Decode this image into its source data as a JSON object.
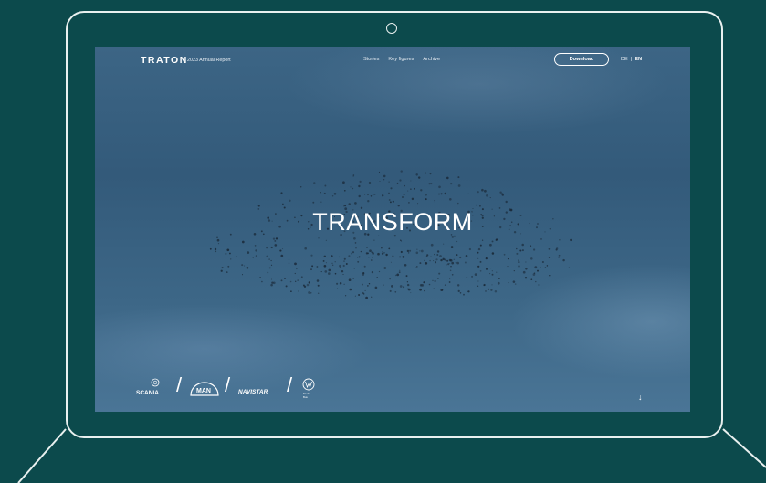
{
  "nav": {
    "logo": "TRATON",
    "subtitle": "/ 2023 Annual Report",
    "links": [
      "Stories",
      "Key figures",
      "Archive"
    ],
    "download_label": "Download",
    "lang_de": "DE",
    "lang_sep": "|",
    "lang_en": "EN"
  },
  "hero": {
    "title": "TRANSFORM",
    "scroll_icon": "arrow-down-icon"
  },
  "brands": {
    "scania": "SCANIA",
    "man": "MAN",
    "navistar": "NAVISTAR",
    "vw_label": "Truck\nBus",
    "separator": "/"
  },
  "colors": {
    "background": "#0c4a4c",
    "frame": "#e9f0ef",
    "sky_top": "#3c6585",
    "sky_bottom": "#4a7596",
    "text": "#ffffff"
  }
}
